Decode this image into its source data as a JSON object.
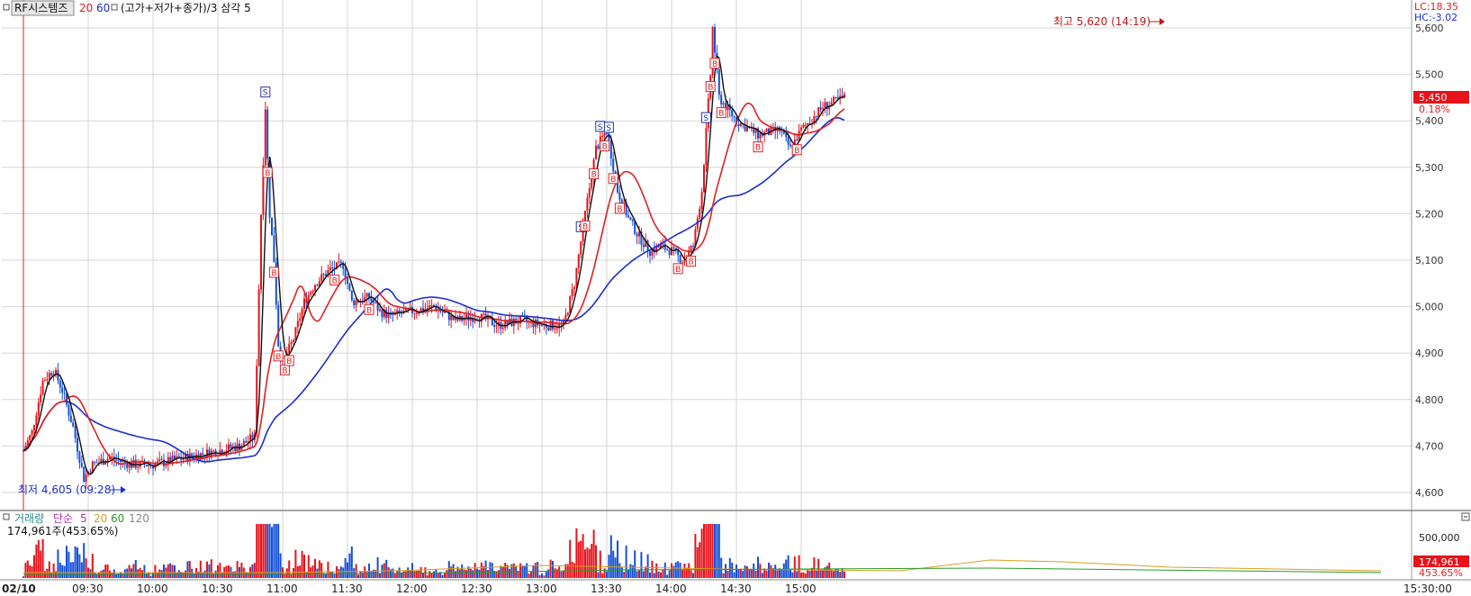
{
  "legend": {
    "indicator_name": "RF시스템즈",
    "ma1": "20",
    "ma2": "60",
    "formula": "(고가+저가+종가)/3 삼각 5"
  },
  "volume_legend": {
    "title": "거래량",
    "ma_type": "단순",
    "p5": "5",
    "p20": "20",
    "p60": "60",
    "p120": "120",
    "current": "174,961주(453.65%)"
  },
  "right_panel": {
    "lc": "LC:18.35",
    "hc": "HC:-3.02",
    "price_tag": "5,450",
    "change_tag": "0.18%",
    "volume_tag": "174,961",
    "volume_pct_tag": "453.65%",
    "volume_axis_label": "500,000"
  },
  "annotations": {
    "high_label": "최고 5,620 (14:19)",
    "low_label": "최저 4,605 (09:28)"
  },
  "colors": {
    "up": "#e8121a",
    "down": "#1450d8",
    "ma20": "#e02020",
    "ma60": "#1a2fd0",
    "triangle": "#111111",
    "grid": "#d6d6d6",
    "signal_buy": "#e02020",
    "signal_sell": "#2233aa"
  },
  "chart_data": {
    "type": "candlestick",
    "title": "",
    "date": "02/10",
    "x_tick_labels": [
      "02/10",
      "09:30",
      "10:00",
      "10:30",
      "11:00",
      "11:30",
      "12:00",
      "12:30",
      "13:00",
      "13:30",
      "14:00",
      "14:30",
      "15:00",
      "15:30:00"
    ],
    "y_tick_labels": [
      "4,600",
      "4,700",
      "4,800",
      "4,900",
      "5,000",
      "5,100",
      "5,200",
      "5,300",
      "5,400",
      "5,500",
      "5,600"
    ],
    "ylim": [
      4570,
      5640
    ],
    "day_high": 5620,
    "day_high_time": "14:19",
    "day_low": 4605,
    "day_low_time": "09:28",
    "last_price": 5450,
    "price_path": [
      [
        "09:00",
        4690
      ],
      [
        "09:04",
        4730
      ],
      [
        "09:09",
        4840
      ],
      [
        "09:14",
        4865
      ],
      [
        "09:18",
        4820
      ],
      [
        "09:23",
        4740
      ],
      [
        "09:28",
        4630
      ],
      [
        "09:32",
        4660
      ],
      [
        "09:40",
        4675
      ],
      [
        "09:50",
        4660
      ],
      [
        "10:00",
        4660
      ],
      [
        "10:10",
        4670
      ],
      [
        "10:20",
        4680
      ],
      [
        "10:30",
        4690
      ],
      [
        "10:40",
        4700
      ],
      [
        "10:47",
        4720
      ],
      [
        "10:50",
        5200
      ],
      [
        "10:52",
        5430
      ],
      [
        "10:54",
        5200
      ],
      [
        "10:56",
        5100
      ],
      [
        "10:58",
        4920
      ],
      [
        "11:00",
        4880
      ],
      [
        "11:05",
        4930
      ],
      [
        "11:10",
        5010
      ],
      [
        "11:15",
        5050
      ],
      [
        "11:22",
        5080
      ],
      [
        "11:28",
        5090
      ],
      [
        "11:32",
        5010
      ],
      [
        "11:40",
        5020
      ],
      [
        "11:45",
        4990
      ],
      [
        "11:50",
        4980
      ],
      [
        "12:00",
        4990
      ],
      [
        "12:10",
        5000
      ],
      [
        "12:20",
        4970
      ],
      [
        "12:30",
        4980
      ],
      [
        "12:40",
        4960
      ],
      [
        "12:50",
        4970
      ],
      [
        "13:00",
        4960
      ],
      [
        "13:10",
        4960
      ],
      [
        "13:15",
        5050
      ],
      [
        "13:20",
        5200
      ],
      [
        "13:25",
        5340
      ],
      [
        "13:30",
        5380
      ],
      [
        "13:35",
        5250
      ],
      [
        "13:40",
        5190
      ],
      [
        "13:45",
        5150
      ],
      [
        "13:50",
        5120
      ],
      [
        "13:55",
        5130
      ],
      [
        "14:00",
        5120
      ],
      [
        "14:05",
        5100
      ],
      [
        "14:10",
        5130
      ],
      [
        "14:14",
        5250
      ],
      [
        "14:18",
        5500
      ],
      [
        "14:19",
        5600
      ],
      [
        "14:22",
        5450
      ],
      [
        "14:30",
        5400
      ],
      [
        "14:40",
        5370
      ],
      [
        "14:50",
        5380
      ],
      [
        "14:55",
        5340
      ],
      [
        "15:00",
        5380
      ],
      [
        "15:10",
        5430
      ],
      [
        "15:15",
        5440
      ],
      [
        "15:20",
        5450
      ]
    ],
    "volume": {
      "axis_tick": 500000,
      "last": 174961,
      "last_pct": 453.65
    },
    "grid": true
  }
}
